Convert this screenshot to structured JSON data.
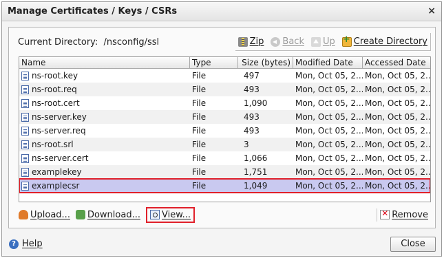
{
  "window": {
    "title": "Manage Certificates / Keys / CSRs",
    "close_glyph": "×"
  },
  "toolbar": {
    "current_dir_label": "Current Directory:",
    "current_dir_path": "/nsconfig/ssl",
    "zip": "Zip",
    "back": "Back",
    "up": "Up",
    "create_directory": "Create Directory"
  },
  "table": {
    "columns": [
      "Name",
      "Type",
      "Size (bytes)",
      "Modified Date",
      "Accessed Date"
    ],
    "rows": [
      {
        "name": "ns-root.key",
        "type": "File",
        "size": "497",
        "modified": "Mon, Oct 05, 2...",
        "accessed": "Mon, Oct 05, 2..."
      },
      {
        "name": "ns-root.req",
        "type": "File",
        "size": "493",
        "modified": "Mon, Oct 05, 2...",
        "accessed": "Mon, Oct 05, 2..."
      },
      {
        "name": "ns-root.cert",
        "type": "File",
        "size": "1,090",
        "modified": "Mon, Oct 05, 2...",
        "accessed": "Mon, Oct 05, 2..."
      },
      {
        "name": "ns-server.key",
        "type": "File",
        "size": "493",
        "modified": "Mon, Oct 05, 2...",
        "accessed": "Mon, Oct 05, 2..."
      },
      {
        "name": "ns-server.req",
        "type": "File",
        "size": "493",
        "modified": "Mon, Oct 05, 2...",
        "accessed": "Mon, Oct 05, 2..."
      },
      {
        "name": "ns-root.srl",
        "type": "File",
        "size": "3",
        "modified": "Mon, Oct 05, 2...",
        "accessed": "Mon, Oct 05, 2..."
      },
      {
        "name": "ns-server.cert",
        "type": "File",
        "size": "1,066",
        "modified": "Mon, Oct 05, 2...",
        "accessed": "Mon, Oct 05, 2..."
      },
      {
        "name": "examplekey",
        "type": "File",
        "size": "1,751",
        "modified": "Mon, Oct 05, 2...",
        "accessed": "Mon, Oct 05, 2..."
      },
      {
        "name": "examplecsr",
        "type": "File",
        "size": "1,049",
        "modified": "Mon, Oct 05, 2...",
        "accessed": "Mon, Oct 05, 2..."
      }
    ],
    "selected_row": 8
  },
  "actions": {
    "upload": "Upload...",
    "download": "Download...",
    "view": "View...",
    "remove": "Remove"
  },
  "footer": {
    "help": "Help",
    "close": "Close"
  },
  "icons": {
    "zip": "zip-icon",
    "back": "back-arrow-icon",
    "up": "up-arrow-icon",
    "create_directory": "new-folder-icon",
    "file": "file-icon",
    "upload": "upload-icon",
    "download": "download-icon",
    "view": "view-icon",
    "remove": "remove-icon",
    "help": "help-icon"
  },
  "colors": {
    "selection": "#c9c9f0",
    "highlight_border": "#e0202a"
  }
}
